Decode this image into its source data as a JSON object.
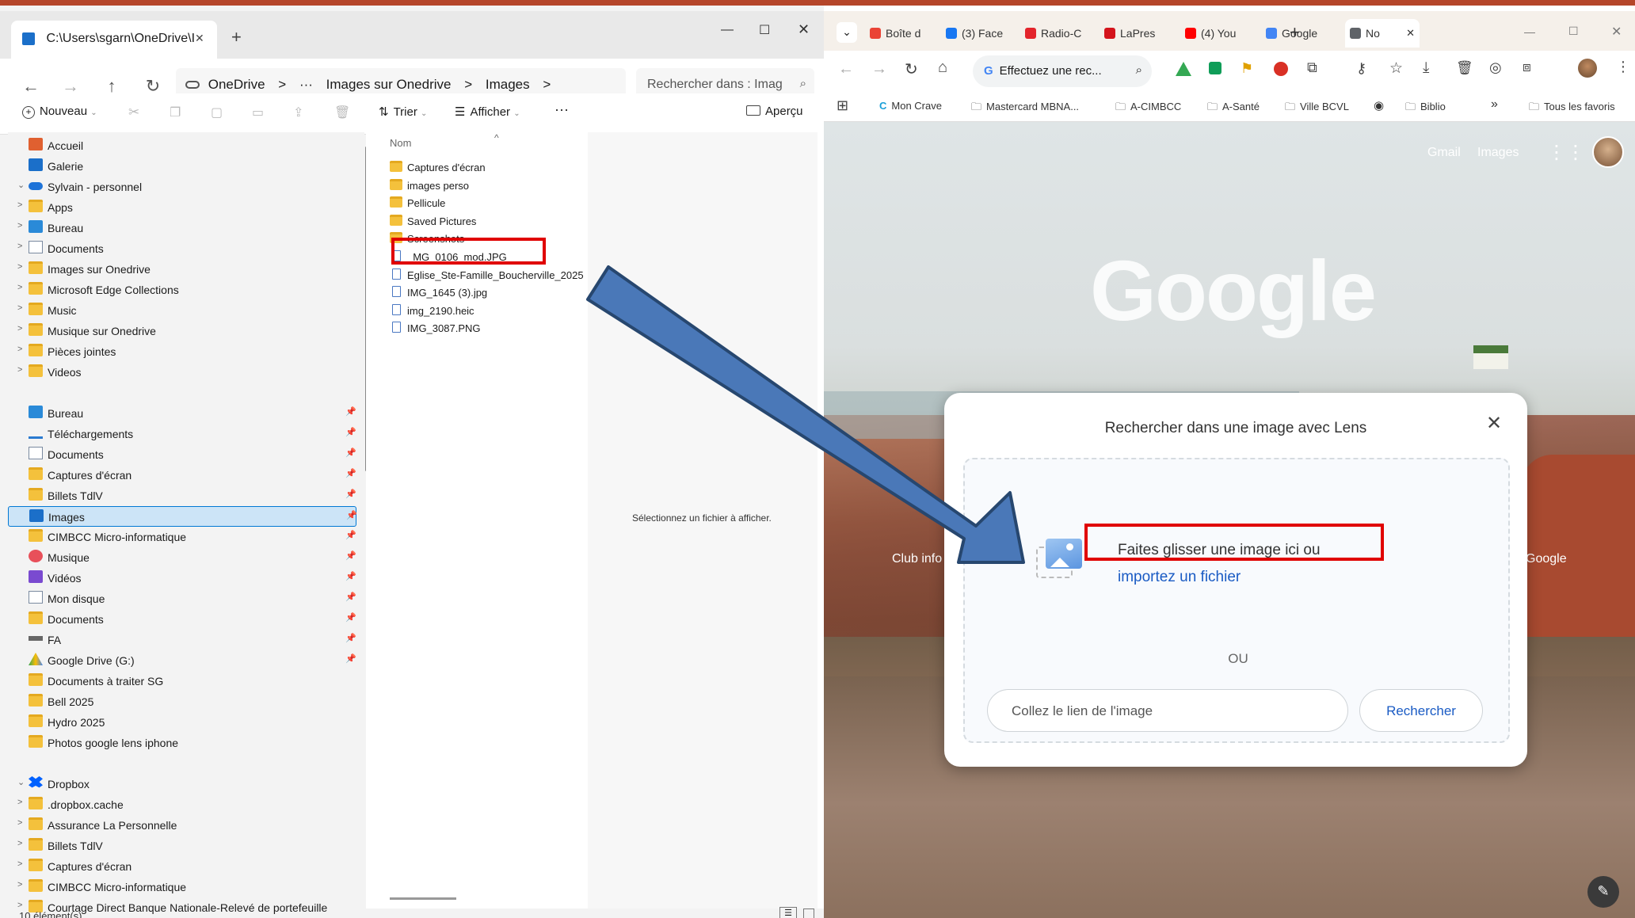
{
  "explorer": {
    "tab_title": "C:\\Users\\sgarn\\OneDrive\\I",
    "tab_close": "✕",
    "tab_add": "+",
    "window_controls": [
      "—",
      "☐",
      "✕"
    ],
    "breadcrumbs": [
      "OneDrive",
      ">",
      "···",
      "Images sur Onedrive",
      ">",
      "Images",
      ">"
    ],
    "search_placeholder": "Rechercher dans : Imag",
    "toolbar": {
      "new_label": "Nouveau",
      "sort_label": "Trier",
      "view_label": "Afficher",
      "more_label": "···",
      "preview_label": "Aperçu"
    },
    "nav_items": [
      {
        "label": "Accueil",
        "chev": "",
        "icon": "home",
        "pin": ""
      },
      {
        "label": "Galerie",
        "chev": "",
        "icon": "gallery",
        "pin": ""
      },
      {
        "label": "Sylvain - personnel",
        "chev": "⌄",
        "icon": "cloud",
        "pin": ""
      },
      {
        "label": "Apps",
        "chev": ">",
        "icon": "folder",
        "pin": ""
      },
      {
        "label": "Bureau",
        "chev": ">",
        "icon": "desktop",
        "pin": ""
      },
      {
        "label": "Documents",
        "chev": ">",
        "icon": "doc",
        "pin": ""
      },
      {
        "label": "Images sur Onedrive",
        "chev": ">",
        "icon": "folder",
        "pin": ""
      },
      {
        "label": "Microsoft Edge Collections",
        "chev": ">",
        "icon": "folder",
        "pin": ""
      },
      {
        "label": "Music",
        "chev": ">",
        "icon": "folder",
        "pin": ""
      },
      {
        "label": "Musique sur Onedrive",
        "chev": ">",
        "icon": "folder",
        "pin": ""
      },
      {
        "label": "Pièces jointes",
        "chev": ">",
        "icon": "folder",
        "pin": ""
      },
      {
        "label": "Videos",
        "chev": ">",
        "icon": "folder",
        "pin": ""
      },
      {
        "label": "Bureau",
        "chev": "",
        "icon": "desktop",
        "pin": "📌"
      },
      {
        "label": "Téléchargements",
        "chev": "",
        "icon": "download",
        "pin": "📌"
      },
      {
        "label": "Documents",
        "chev": "",
        "icon": "doc",
        "pin": "📌"
      },
      {
        "label": "Captures d'écran",
        "chev": "",
        "icon": "folder",
        "pin": "📌"
      },
      {
        "label": "Billets TdlV",
        "chev": "",
        "icon": "folder",
        "pin": "📌"
      },
      {
        "label": "Images",
        "chev": "",
        "icon": "gallery",
        "pin": "📌",
        "selected": true
      },
      {
        "label": "CIMBCC Micro-informatique",
        "chev": "",
        "icon": "folder",
        "pin": "📌"
      },
      {
        "label": "Musique",
        "chev": "",
        "icon": "music",
        "pin": "📌"
      },
      {
        "label": "Vidéos",
        "chev": "",
        "icon": "video",
        "pin": "📌"
      },
      {
        "label": "Mon disque",
        "chev": "",
        "icon": "doc",
        "pin": "📌"
      },
      {
        "label": "Documents",
        "chev": "",
        "icon": "folder",
        "pin": "📌"
      },
      {
        "label": "FA",
        "chev": "",
        "icon": "drive",
        "pin": "📌"
      },
      {
        "label": "Google Drive (G:)",
        "chev": "",
        "icon": "gdrive",
        "pin": "📌"
      },
      {
        "label": "Documents à traiter SG",
        "chev": "",
        "icon": "folder",
        "pin": ""
      },
      {
        "label": "Bell 2025",
        "chev": "",
        "icon": "folder",
        "pin": ""
      },
      {
        "label": "Hydro 2025",
        "chev": "",
        "icon": "folder",
        "pin": ""
      },
      {
        "label": "Photos google lens iphone",
        "chev": "",
        "icon": "folder",
        "pin": ""
      },
      {
        "label": "Dropbox",
        "chev": "⌄",
        "icon": "dropbox",
        "pin": ""
      },
      {
        "label": ".dropbox.cache",
        "chev": ">",
        "icon": "folder",
        "pin": ""
      },
      {
        "label": "Assurance La Personnelle",
        "chev": ">",
        "icon": "folder",
        "pin": ""
      },
      {
        "label": "Billets TdlV",
        "chev": ">",
        "icon": "folder",
        "pin": ""
      },
      {
        "label": "Captures d'écran",
        "chev": ">",
        "icon": "folder",
        "pin": ""
      },
      {
        "label": "CIMBCC Micro-informatique",
        "chev": ">",
        "icon": "folder",
        "pin": ""
      },
      {
        "label": "Courtage Direct Banque Nationale-Relevé de portefeuille",
        "chev": ">",
        "icon": "folder",
        "pin": ""
      }
    ],
    "status": "10 élément(s)",
    "column_header": "Nom",
    "sort_arrow": "^",
    "files": [
      {
        "label": "Captures d'écran",
        "type": "folder"
      },
      {
        "label": "images perso",
        "type": "folder"
      },
      {
        "label": "Pellicule",
        "type": "folder"
      },
      {
        "label": "Saved Pictures",
        "type": "folder"
      },
      {
        "label": "Screenshots",
        "type": "folder"
      },
      {
        "label": "_MG_0106_mod.JPG",
        "type": "file"
      },
      {
        "label": "Eglise_Ste-Famille_Boucherville_2025",
        "type": "file"
      },
      {
        "label": "IMG_1645 (3).jpg",
        "type": "file"
      },
      {
        "label": "img_2190.heic",
        "type": "file"
      },
      {
        "label": "IMG_3087.PNG",
        "type": "file"
      }
    ],
    "preview_message": "Sélectionnez un fichier à afficher."
  },
  "browser": {
    "tabs": [
      {
        "label": "Boîte d",
        "icon_color": "#ea4335"
      },
      {
        "label": "(3) Face",
        "icon_color": "#1877f2"
      },
      {
        "label": "Radio-C",
        "icon_color": "#e3242b"
      },
      {
        "label": "LaPres",
        "icon_color": "#d4141c"
      },
      {
        "label": "(4) You",
        "icon_color": "#ff0000"
      },
      {
        "label": "Google",
        "icon_color": "#4285f4"
      },
      {
        "label": "No",
        "icon_color": "#5f6368",
        "active": true
      }
    ],
    "new_tab": "+",
    "close_tab": "✕",
    "window_controls": [
      "—",
      "☐",
      "✕"
    ],
    "omnibox_text": "Effectuez une rec...",
    "bookmarks": [
      "Mon Crave",
      "Mastercard MBNA...",
      "A-CIMBCC",
      "A-Santé",
      "Ville BCVL",
      "Biblio",
      "Tous les favoris"
    ],
    "bookmarks_more": "»",
    "top_links": [
      "Gmail",
      "Images"
    ],
    "google_logo": "Google",
    "shortcut_left": "Club info",
    "shortcut_right": "Google",
    "lens": {
      "title": "Rechercher dans une image avec Lens",
      "drag_text": "Faites glisser une image ici ou",
      "upload_link": "importez un fichier",
      "or_text": "OU",
      "paste_placeholder": "Collez le lien de l'image",
      "search_button": "Rechercher"
    }
  },
  "colors": {
    "highlight_red": "#e00000",
    "arrow_blue": "#4a78b8",
    "link_blue": "#1a5bc4",
    "folder_yellow": "#f4c13c"
  }
}
